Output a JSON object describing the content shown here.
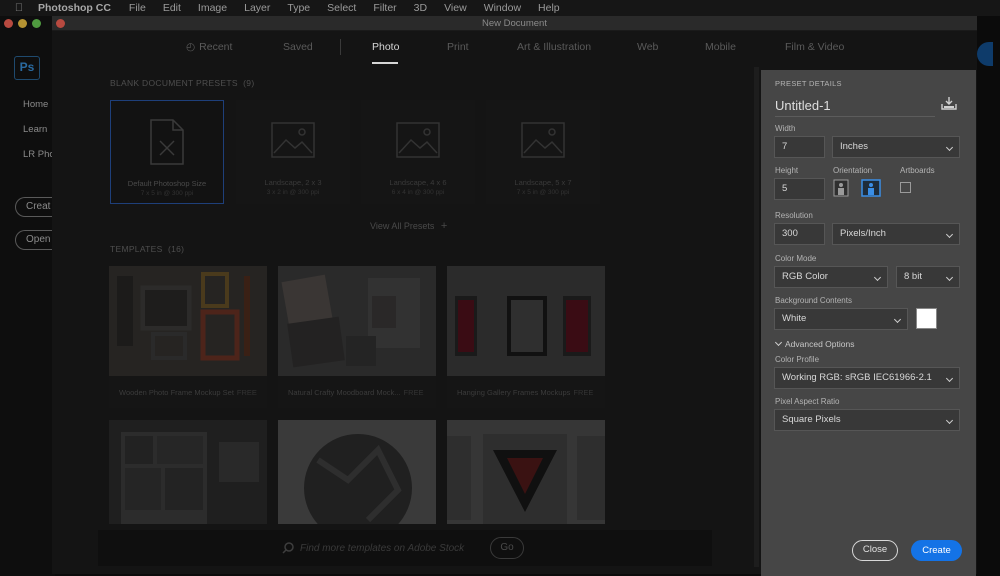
{
  "menubar": {
    "app_name": "Photoshop CC",
    "items": [
      "File",
      "Edit",
      "Image",
      "Layer",
      "Type",
      "Select",
      "Filter",
      "3D",
      "View",
      "Window",
      "Help"
    ]
  },
  "home": {
    "logo": "Ps",
    "links": [
      "Home",
      "Learn",
      "LR Pho"
    ],
    "create_label": "Creat",
    "open_label": "Open"
  },
  "dialog": {
    "title": "New Document",
    "tabs": [
      "Recent",
      "Saved",
      "Photo",
      "Print",
      "Art & Illustration",
      "Web",
      "Mobile",
      "Film & Video"
    ],
    "active_tab": "Photo",
    "presets_label": "BLANK DOCUMENT PRESETS",
    "presets_count": "(9)",
    "presets": [
      {
        "name": "Default Photoshop Size",
        "sub": "7 x 5 in @ 300 ppi"
      },
      {
        "name": "Landscape, 2 x 3",
        "sub": "3 x 2 in @ 300 ppi"
      },
      {
        "name": "Landscape, 4 x 6",
        "sub": "6 x 4 in @ 300 ppi"
      },
      {
        "name": "Landscape, 5 x 7",
        "sub": "7 x 5 in @ 300 ppi"
      }
    ],
    "view_all": "View All Presets",
    "templates_label": "TEMPLATES",
    "templates_count": "(16)",
    "templates": [
      {
        "name": "Wooden Photo Frame Mockup Set",
        "badge": "FREE"
      },
      {
        "name": "Natural Crafty Moodboard Mock...",
        "badge": "FREE"
      },
      {
        "name": "Hanging Gallery Frames Mockups",
        "badge": "FREE"
      }
    ],
    "search_placeholder": "Find more templates on Adobe Stock",
    "go_label": "Go"
  },
  "panel": {
    "header": "PRESET DETAILS",
    "doc_name": "Untitled-1",
    "width_label": "Width",
    "width_value": "7",
    "width_unit": "Inches",
    "height_label": "Height",
    "height_value": "5",
    "orientation_label": "Orientation",
    "artboards_label": "Artboards",
    "resolution_label": "Resolution",
    "resolution_value": "300",
    "resolution_unit": "Pixels/Inch",
    "color_mode_label": "Color Mode",
    "color_mode_value": "RGB Color",
    "bit_depth": "8 bit",
    "bg_label": "Background Contents",
    "bg_value": "White",
    "bg_color": "#ffffff",
    "advanced_label": "Advanced Options",
    "color_profile_label": "Color Profile",
    "color_profile_value": "Working RGB: sRGB IEC61966-2.1",
    "pixel_aspect_label": "Pixel Aspect Ratio",
    "pixel_aspect_value": "Square Pixels",
    "close_label": "Close",
    "create_label": "Create"
  },
  "colors": {
    "accent": "#1473e6",
    "panel_bg": "#464646"
  }
}
